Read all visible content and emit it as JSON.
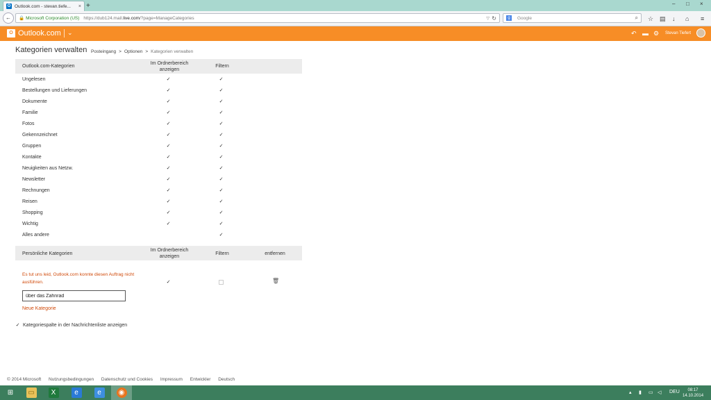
{
  "browser": {
    "tab_title": "Outlook.com - stevan.tiefe...",
    "secure_label": "Microsoft Corporation (US)",
    "url_prefix": "https://dub124.mail.",
    "url_domain": "live.com",
    "url_suffix": "/?page=ManageCategories",
    "search_placeholder": "Google",
    "search_engine_label": "g",
    "favicon_label": "O"
  },
  "app": {
    "logo_label": "O",
    "brand": "Outlook.com",
    "user_name": "Stevan Tiefert"
  },
  "page": {
    "title": "Kategorien verwalten",
    "breadcrumb": [
      "Posteingang",
      "Optionen",
      "Kategorien verwalten"
    ],
    "breadcrumb_sep": ">"
  },
  "outlook_table": {
    "headers": {
      "name": "Outlook.com-Kategorien",
      "folder": "Im Ordnerbereich anzeigen",
      "filter": "Filtern"
    },
    "rows": [
      {
        "name": "Ungelesen",
        "folder": true,
        "filter": true
      },
      {
        "name": "Bestellungen und Lieferungen",
        "folder": true,
        "filter": true
      },
      {
        "name": "Dokumente",
        "folder": true,
        "filter": true
      },
      {
        "name": "Familie",
        "folder": true,
        "filter": true
      },
      {
        "name": "Fotos",
        "folder": true,
        "filter": true
      },
      {
        "name": "Gekennzeichnet",
        "folder": true,
        "filter": true
      },
      {
        "name": "Gruppen",
        "folder": true,
        "filter": true
      },
      {
        "name": "Kontakte",
        "folder": true,
        "filter": true
      },
      {
        "name": "Neuigkeiten aus Netzw.",
        "folder": true,
        "filter": true
      },
      {
        "name": "Newsletter",
        "folder": true,
        "filter": true
      },
      {
        "name": "Rechnungen",
        "folder": true,
        "filter": true
      },
      {
        "name": "Reisen",
        "folder": true,
        "filter": true
      },
      {
        "name": "Shopping",
        "folder": true,
        "filter": true
      },
      {
        "name": "Wichtig",
        "folder": true,
        "filter": true
      },
      {
        "name": "Alles andere",
        "folder": false,
        "filter": true
      }
    ]
  },
  "personal_table": {
    "headers": {
      "name": "Persönliche Kategorien",
      "folder": "Im Ordnerbereich anzeigen",
      "filter": "Filtern",
      "remove": "entfernen"
    },
    "error": "Es tut uns leid, Outlook.com konnte diesen Auftrag nicht ausführen.",
    "row": {
      "folder": true,
      "filter": false
    },
    "input_value": "über das Zahnrad",
    "new_category_link": "Neue Kategorie",
    "show_column_label": "Kategoriespalte in der Nachrichtenliste anzeigen",
    "show_column_checked": true
  },
  "footer": [
    "© 2014 Microsoft",
    "Nutzungsbedingungen",
    "Datenschutz und Cookies",
    "Impressum",
    "Entwickler",
    "Deutsch"
  ],
  "taskbar": {
    "language": "DEU",
    "time": "08:17",
    "date": "14.10.2014"
  },
  "colors": {
    "outlook_orange": "#f78d26",
    "error_orange": "#d04a0a",
    "taskbar_green": "#3c7e5d"
  },
  "glyphs": {
    "check": "✓",
    "back": "←",
    "plus": "+",
    "close": "×",
    "minimize": "–",
    "maximize": "□",
    "lock": "🔒",
    "reload": "↻",
    "dropdown": "▽",
    "search": "⌕",
    "chevron": "⌄",
    "trash": "🗑",
    "start": "⊞"
  }
}
